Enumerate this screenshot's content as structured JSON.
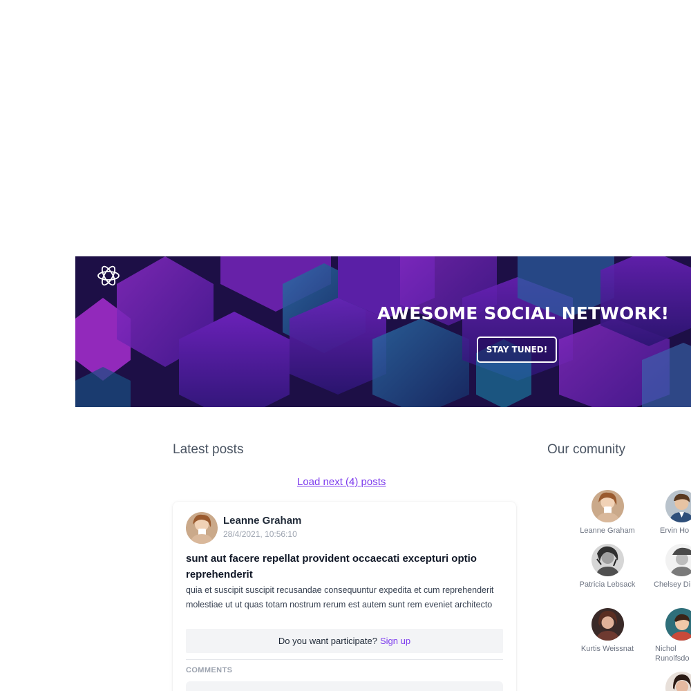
{
  "hero": {
    "title": "AWESOME SOCIAL NETWORK!",
    "cta_label": "STAY TUNED!",
    "logo_icon": "react-atom-logo-icon"
  },
  "posts_section": {
    "title": "Latest posts",
    "load_next_label": "Load next (4) posts"
  },
  "post": {
    "author": "Leanne Graham",
    "date": "28/4/2021, 10:56:10",
    "title": "sunt aut facere repellat provident occaecati excepturi optio reprehenderit",
    "body": "quia et suscipit suscipit recusandae consequuntur expedita et cum reprehenderit molestiae ut ut quas totam nostrum rerum est autem sunt rem eveniet architecto",
    "participate_text": "Do you want participate?",
    "signup_label": "Sign up",
    "comments_label": "COMMENTS"
  },
  "community": {
    "title": "Our comunity",
    "members": [
      {
        "name": "Leanne Graham"
      },
      {
        "name": "Ervin Ho"
      },
      {
        "name": "Patricia Lebsack"
      },
      {
        "name": "Chelsey Di"
      },
      {
        "name": "Kurtis Weissnat"
      },
      {
        "name": "Nichol Runolfsdo"
      }
    ]
  },
  "colors": {
    "accent": "#7c3aed",
    "hero_purple": "#4b1780"
  }
}
